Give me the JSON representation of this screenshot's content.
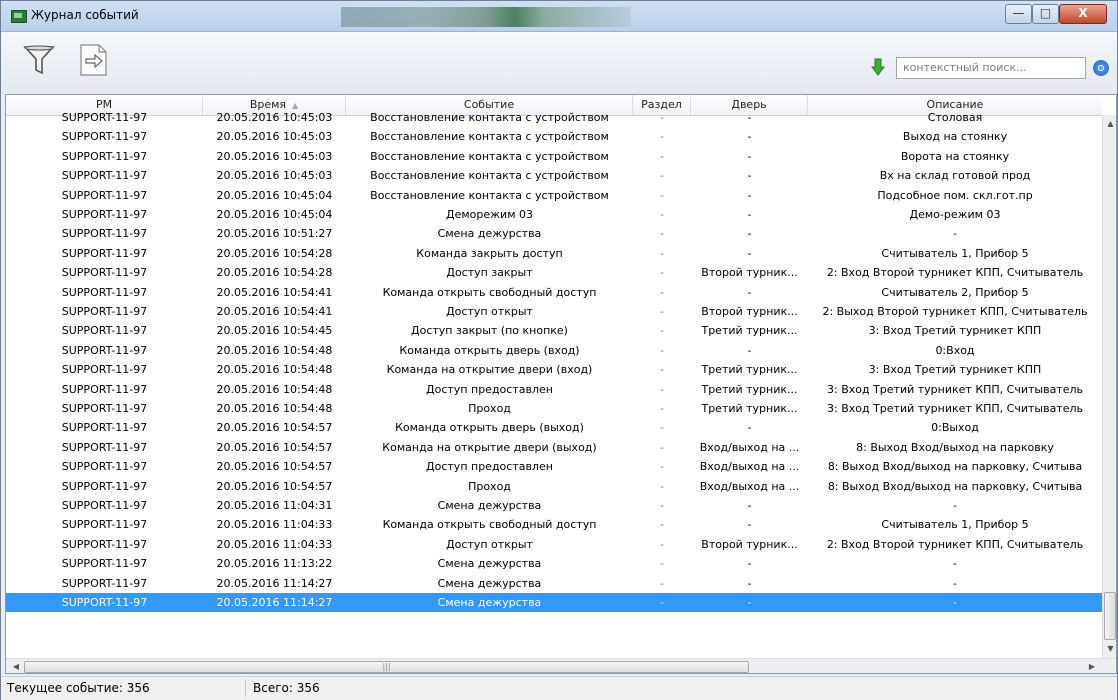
{
  "window": {
    "title": "Журнал событий"
  },
  "toolbar": {
    "filter_icon": "filter-icon",
    "export_icon": "export-icon",
    "sort_icon": "arrow-down-icon",
    "search_placeholder": "контекстный поиск...",
    "search_icon": "search-icon"
  },
  "columns": [
    "РМ",
    "Время",
    "Событие",
    "Раздел",
    "Дверь",
    "Описание"
  ],
  "rows": [
    [
      "SUPPORT-11-97",
      "20.05.2016 10:45:03",
      "Восстановление контакта с устройством",
      "-",
      "-",
      "Столовая"
    ],
    [
      "SUPPORT-11-97",
      "20.05.2016 10:45:03",
      "Восстановление контакта с устройством",
      "-",
      "-",
      "Выход на стоянку"
    ],
    [
      "SUPPORT-11-97",
      "20.05.2016 10:45:03",
      "Восстановление контакта с устройством",
      "-",
      "-",
      "Ворота на стоянку"
    ],
    [
      "SUPPORT-11-97",
      "20.05.2016 10:45:03",
      "Восстановление контакта с устройством",
      "-",
      "-",
      "Вх на склад готовой прод"
    ],
    [
      "SUPPORT-11-97",
      "20.05.2016 10:45:04",
      "Восстановление контакта с устройством",
      "-",
      "-",
      "Подсобное пом. скл.гот.пр"
    ],
    [
      "SUPPORT-11-97",
      "20.05.2016 10:45:04",
      "Деморежим 03",
      "-",
      "-",
      "Демо-режим 03"
    ],
    [
      "SUPPORT-11-97",
      "20.05.2016 10:51:27",
      "Смена дежурства",
      "-",
      "-",
      "-"
    ],
    [
      "SUPPORT-11-97",
      "20.05.2016 10:54:28",
      "Команда закрыть доступ",
      "-",
      "-",
      "Считыватель 1, Прибор 5"
    ],
    [
      "SUPPORT-11-97",
      "20.05.2016 10:54:28",
      "Доступ закрыт",
      "-",
      "Второй турник...",
      "2: Вход  Второй турникет КПП,  Считыватель"
    ],
    [
      "SUPPORT-11-97",
      "20.05.2016 10:54:41",
      "Команда открыть свободный доступ",
      "-",
      "-",
      "Считыватель 2, Прибор 5"
    ],
    [
      "SUPPORT-11-97",
      "20.05.2016 10:54:41",
      "Доступ открыт",
      "-",
      "Второй турник...",
      "2: Выход  Второй турникет КПП,  Считыватель"
    ],
    [
      "SUPPORT-11-97",
      "20.05.2016 10:54:45",
      "Доступ закрыт (по кнопке)",
      "-",
      "Третий турник...",
      "3: Вход  Третий турникет КПП"
    ],
    [
      "SUPPORT-11-97",
      "20.05.2016 10:54:48",
      "Команда открыть дверь (вход)",
      "-",
      "-",
      "0:Вход"
    ],
    [
      "SUPPORT-11-97",
      "20.05.2016 10:54:48",
      "Команда на открытие двери (вход)",
      "-",
      "Третий турник...",
      "3: Вход  Третий турникет КПП"
    ],
    [
      "SUPPORT-11-97",
      "20.05.2016 10:54:48",
      "Доступ предоставлен",
      "-",
      "Третий турник...",
      "3: Вход  Третий турникет КПП,  Считыватель"
    ],
    [
      "SUPPORT-11-97",
      "20.05.2016 10:54:48",
      "Проход",
      "-",
      "Третий турник...",
      "3: Вход  Третий турникет КПП,  Считыватель"
    ],
    [
      "SUPPORT-11-97",
      "20.05.2016 10:54:57",
      "Команда открыть дверь (выход)",
      "-",
      "-",
      "0:Выход"
    ],
    [
      "SUPPORT-11-97",
      "20.05.2016 10:54:57",
      "Команда на открытие двери (выход)",
      "-",
      "Вход/выход на ...",
      "8: Выход  Вход/выход на парковку"
    ],
    [
      "SUPPORT-11-97",
      "20.05.2016 10:54:57",
      "Доступ предоставлен",
      "-",
      "Вход/выход на ...",
      "8: Выход  Вход/выход на парковку,  Считыва"
    ],
    [
      "SUPPORT-11-97",
      "20.05.2016 10:54:57",
      "Проход",
      "-",
      "Вход/выход на ...",
      "8: Выход  Вход/выход на парковку,  Считыва"
    ],
    [
      "SUPPORT-11-97",
      "20.05.2016 11:04:31",
      "Смена дежурства",
      "-",
      "-",
      "-"
    ],
    [
      "SUPPORT-11-97",
      "20.05.2016 11:04:33",
      "Команда открыть свободный доступ",
      "-",
      "-",
      "Считыватель 1, Прибор 5"
    ],
    [
      "SUPPORT-11-97",
      "20.05.2016 11:04:33",
      "Доступ открыт",
      "-",
      "Второй турник...",
      "2: Вход  Второй турникет КПП,  Считыватель"
    ],
    [
      "SUPPORT-11-97",
      "20.05.2016 11:13:22",
      "Смена дежурства",
      "-",
      "-",
      "-"
    ],
    [
      "SUPPORT-11-97",
      "20.05.2016 11:14:27",
      "Смена дежурства",
      "-",
      "-",
      "-"
    ],
    [
      "SUPPORT-11-97",
      "20.05.2016 11:14:27",
      "Смена дежурства",
      "-",
      "-",
      "-"
    ]
  ],
  "selected_row": 25,
  "status": {
    "current": "Текущее событие: 356",
    "total": "Всего: 356"
  },
  "colors": {
    "selection": "#3399ff"
  }
}
